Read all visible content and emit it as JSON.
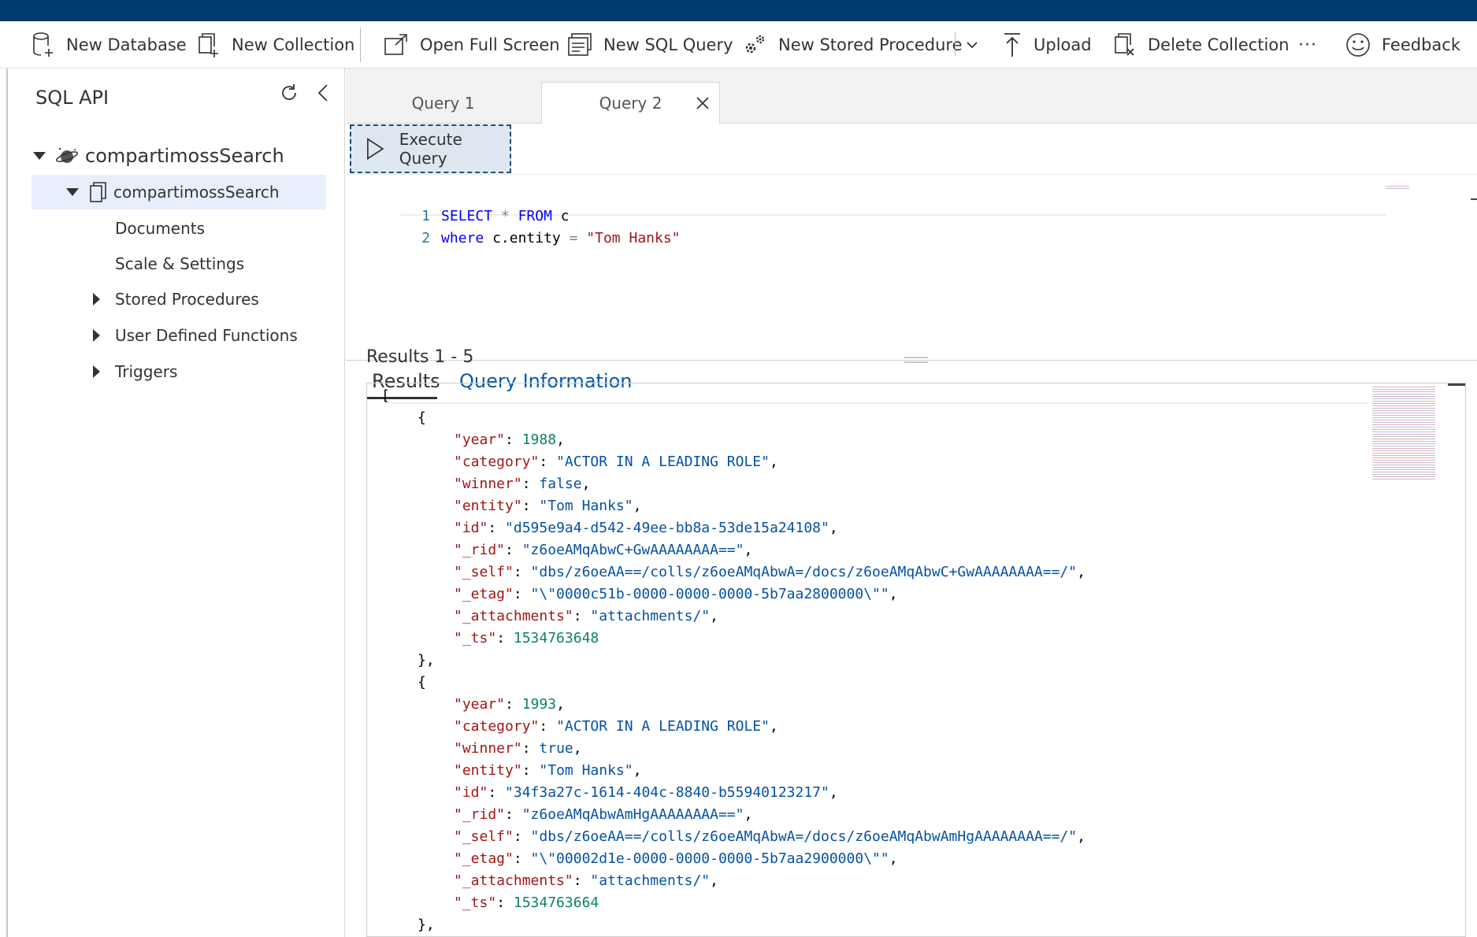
{
  "toolbar": {
    "new_database": "New Database",
    "new_collection": "New Collection",
    "open_full_screen": "Open Full Screen",
    "new_sql_query": "New SQL Query",
    "new_stored_procedure": "New Stored Procedure",
    "upload": "Upload",
    "delete_collection": "Delete Collection",
    "more": "···",
    "feedback": "Feedback"
  },
  "sidebar": {
    "title": "SQL API",
    "database": "compartimossSearch",
    "collection": "compartimossSearch",
    "items": {
      "documents": "Documents",
      "scale_settings": "Scale & Settings",
      "stored_procedures": "Stored Procedures",
      "user_defined_functions": "User Defined Functions",
      "triggers": "Triggers"
    }
  },
  "tabs": {
    "query1": "Query 1",
    "query2": "Query 2"
  },
  "execute_query": "Execute Query",
  "editor": {
    "line1": {
      "num": "1",
      "kw1": "SELECT",
      "op": "*",
      "kw2": "FROM",
      "rest": "c"
    },
    "line2": {
      "num": "2",
      "kw": "where",
      "expr": "c.entity",
      "op": "=",
      "str": "\"Tom Hanks\""
    }
  },
  "results_tabs": {
    "results": "Results",
    "query_information": "Query Information"
  },
  "results_count": "Results 1 - 5",
  "results_json": {
    "open_bracket": "[",
    "open_brace": "{",
    "close_brace": "},",
    "docs": [
      {
        "year": "1988",
        "category": "\"ACTOR IN A LEADING ROLE\"",
        "winner": "false",
        "entity": "\"Tom Hanks\"",
        "id": "\"d595e9a4-d542-49ee-bb8a-53de15a24108\"",
        "_rid": "\"z6oeAMqAbwC+GwAAAAAAAA==\"",
        "_self": "\"dbs/z6oeAA==/colls/z6oeAMqAbwA=/docs/z6oeAMqAbwC+GwAAAAAAAA==/\"",
        "_etag": "\"\\\"0000c51b-0000-0000-0000-5b7aa2800000\\\"\"",
        "_attachments": "\"attachments/\"",
        "_ts": "1534763648"
      },
      {
        "year": "1993",
        "category": "\"ACTOR IN A LEADING ROLE\"",
        "winner": "true",
        "entity": "\"Tom Hanks\"",
        "id": "\"34f3a27c-1614-404c-8840-b55940123217\"",
        "_rid": "\"z6oeAMqAbwAmHgAAAAAAAA==\"",
        "_self": "\"dbs/z6oeAA==/colls/z6oeAMqAbwA=/docs/z6oeAMqAbwAmHgAAAAAAAA==/\"",
        "_etag": "\"\\\"00002d1e-0000-0000-0000-5b7aa2900000\\\"\"",
        "_attachments": "\"attachments/\"",
        "_ts": "1534763664"
      }
    ]
  },
  "colors": {
    "topbar": "#003b6f",
    "link": "#0058ad",
    "selected_row": "#e6effb",
    "execute_bg": "#dee7f0"
  }
}
